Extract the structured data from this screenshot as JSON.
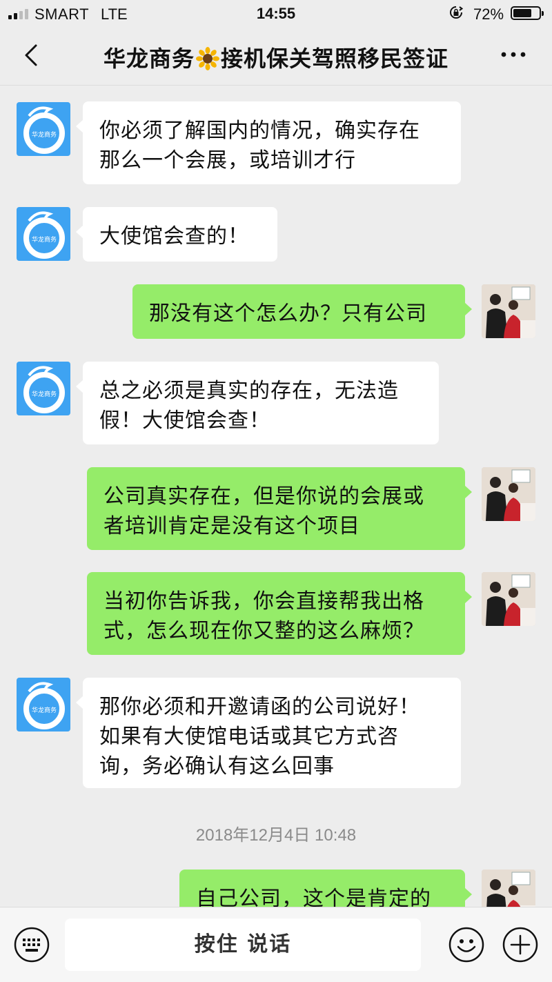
{
  "status_bar": {
    "carrier": "SMART",
    "network": "LTE",
    "time": "14:55",
    "battery_percent": "72%",
    "battery_level": 0.72,
    "signal_bars": 2
  },
  "nav": {
    "title_part1": "华龙商务",
    "title_part2": "接机保关驾照移民签证"
  },
  "messages": [
    {
      "side": "left",
      "lines": [
        "你必须了解国内的情况，确实存在",
        "那么一个会展，或培训才行"
      ]
    },
    {
      "side": "left",
      "lines": [
        "大使馆会查的！"
      ]
    },
    {
      "side": "right",
      "lines": [
        "那没有这个怎么办？只有公司"
      ]
    },
    {
      "side": "left",
      "lines": [
        "总之必须是真实的存在，无法造",
        "假！大使馆会查！"
      ]
    },
    {
      "side": "right",
      "lines": [
        "公司真实存在，但是你说的会展或",
        "者培训肯定是没有这个项目"
      ]
    },
    {
      "side": "right",
      "lines": [
        "当初你告诉我，你会直接帮我出格",
        "式，怎么现在你又整的这么麻烦？"
      ]
    },
    {
      "side": "left",
      "lines": [
        "那你必须和开邀请函的公司说好！",
        "如果有大使馆电话或其它方式咨",
        "询，务必确认有这么回事"
      ]
    },
    {
      "side": "right",
      "lines": [
        "自己公司，这个是肯定的"
      ]
    }
  ],
  "timestamp": "2018年12月4日 10:48",
  "input_bar": {
    "hold_to_talk": "按住 说话"
  },
  "colors": {
    "background": "#ededed",
    "sent_bubble": "#95ec69",
    "received_bubble": "#ffffff",
    "avatar_blue": "#3ea3f2"
  }
}
